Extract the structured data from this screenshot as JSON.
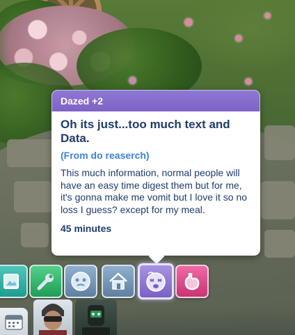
{
  "tooltip": {
    "header": "Dazed +2",
    "title": "Oh its just...too much text and Data.",
    "source": "(From do reaserch)",
    "description": "This much information, normal people will have an easy time digest them but for me, it's gonna make me vomit but I love it so no loss I guess? except for my meal.",
    "duration": "45 minutes",
    "colors": {
      "header": "#8f78d4",
      "title": "#1f3b6b",
      "source": "#3b82d6"
    }
  },
  "moodlets": [
    {
      "icon": "picture-frame-icon",
      "color": "#2fb3a7"
    },
    {
      "icon": "wrench-icon",
      "color": "#2fae6a"
    },
    {
      "icon": "dazed-face-icon",
      "color": "#6f8fb0"
    },
    {
      "icon": "house-icon",
      "color": "#6f8fb0"
    },
    {
      "icon": "dizzy-face-icon",
      "color": "#8a72cc",
      "active": true
    },
    {
      "icon": "stomach-icon",
      "color": "#e04c8f"
    }
  ],
  "bottom_bar": {
    "calendar_icon": "calendar-icon",
    "avatars": [
      "sim-avatar-1",
      "sim-avatar-2"
    ]
  }
}
